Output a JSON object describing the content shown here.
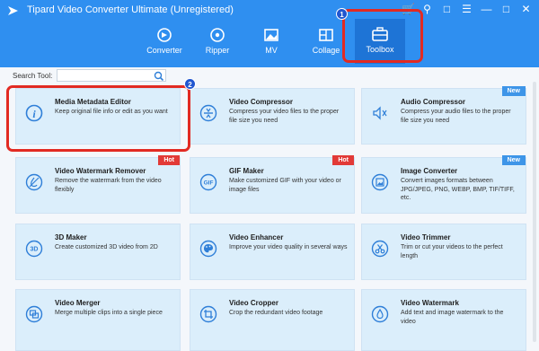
{
  "window": {
    "title": "Tipard Video Converter Ultimate (Unregistered)"
  },
  "nav": {
    "tabs": [
      {
        "label": "Converter",
        "icon": "converter-icon"
      },
      {
        "label": "Ripper",
        "icon": "ripper-disc-icon"
      },
      {
        "label": "MV",
        "icon": "mv-image-icon"
      },
      {
        "label": "Collage",
        "icon": "collage-grid-icon"
      },
      {
        "label": "Toolbox",
        "icon": "toolbox-icon"
      }
    ],
    "active": "Toolbox"
  },
  "annotations": {
    "step1": "1",
    "step2": "2",
    "color": "#e22a22"
  },
  "search": {
    "label": "Search Tool:",
    "value": ""
  },
  "tools": [
    {
      "title": "Media Metadata Editor",
      "desc": "Keep original file info or edit as you want",
      "icon": "info-icon",
      "badge": ""
    },
    {
      "title": "Video Compressor",
      "desc": "Compress your video files to the proper file size you need",
      "icon": "compress-icon",
      "badge": ""
    },
    {
      "title": "Audio Compressor",
      "desc": "Compress your audio files to the proper file size you need",
      "icon": "audio-compress-icon",
      "badge": "New"
    },
    {
      "title": "Video Watermark Remover",
      "desc": "Remove the watermark from the video flexibly",
      "icon": "watermark-remove-icon",
      "badge": "Hot"
    },
    {
      "title": "GIF Maker",
      "desc": "Make customized GIF with your video or image files",
      "icon": "gif-icon",
      "badge": "Hot"
    },
    {
      "title": "Image Converter",
      "desc": "Convert images formats between JPG/JPEG, PNG, WEBP, BMP, TIF/TIFF, etc.",
      "icon": "image-convert-icon",
      "badge": "New"
    },
    {
      "title": "3D Maker",
      "desc": "Create customized 3D video from 2D",
      "icon": "3d-icon",
      "badge": ""
    },
    {
      "title": "Video Enhancer",
      "desc": "Improve your video quality in several ways",
      "icon": "palette-icon",
      "badge": ""
    },
    {
      "title": "Video Trimmer",
      "desc": "Trim or cut your videos to the perfect length",
      "icon": "scissors-icon",
      "badge": ""
    },
    {
      "title": "Video Merger",
      "desc": "Merge multiple clips into a single piece",
      "icon": "merge-icon",
      "badge": ""
    },
    {
      "title": "Video Cropper",
      "desc": "Crop the redundant video footage",
      "icon": "crop-icon",
      "badge": ""
    },
    {
      "title": "Video Watermark",
      "desc": "Add text and image watermark to the video",
      "icon": "watermark-drop-icon",
      "badge": ""
    }
  ],
  "colors": {
    "header": "#2f8ff0",
    "active_tab": "#1e74d6",
    "card": "#dbeefb",
    "hot": "#e23a37",
    "new": "#3e95e8",
    "icon": "#2f7fd8"
  }
}
